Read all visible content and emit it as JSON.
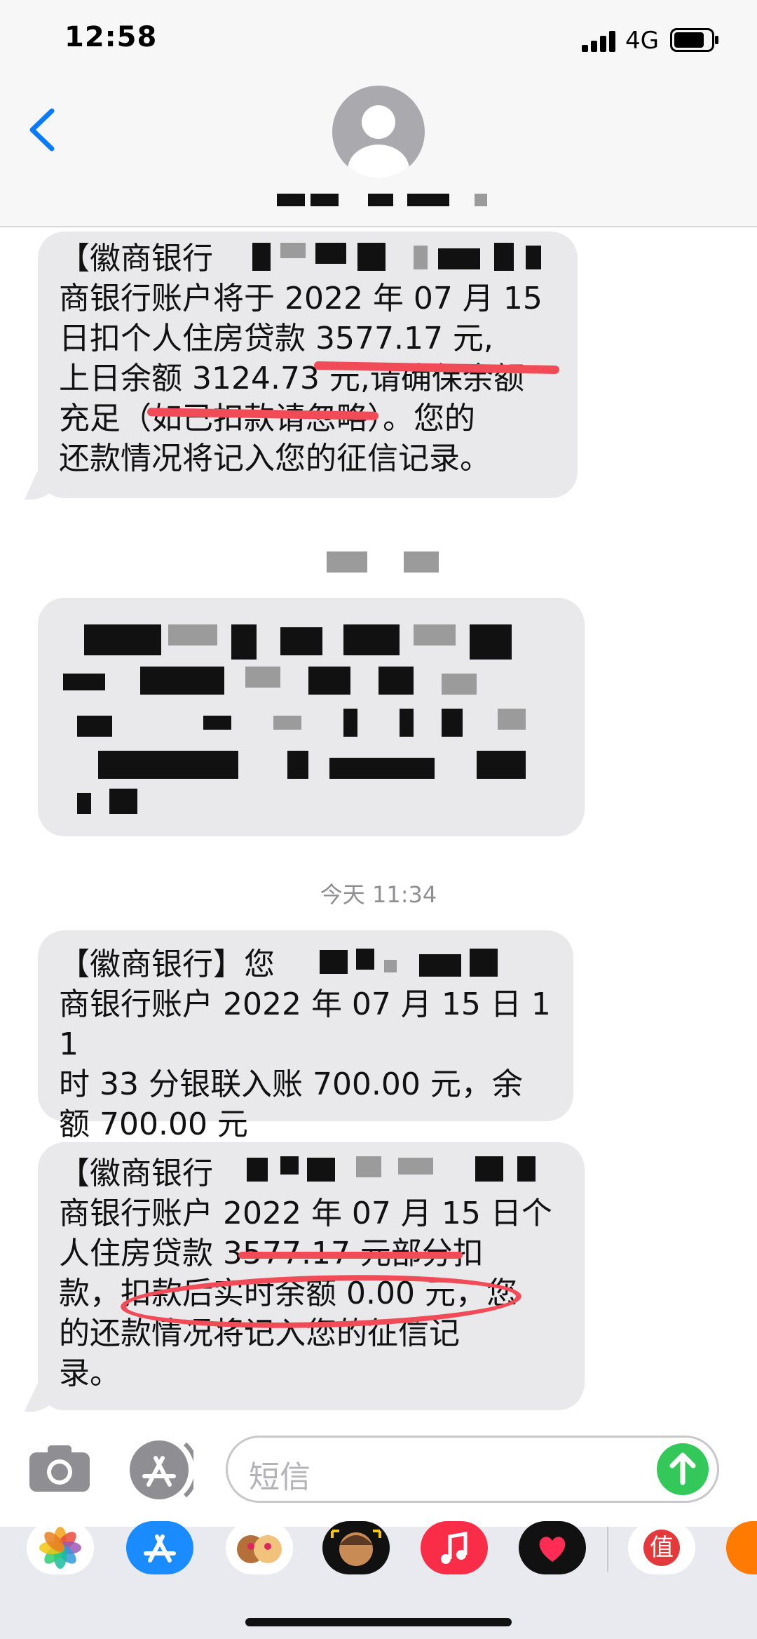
{
  "status_bar": {
    "time": "12:58",
    "network": "4G",
    "icons": [
      "signal-icon",
      "battery-icon"
    ]
  },
  "header": {
    "back_icon": "chevron-left-icon",
    "avatar_icon": "person-icon"
  },
  "messages": [
    {
      "lines": [
        "【徽商银行",
        "商银行账户将于 2022 年 07 月 15",
        "日扣个人住房贷款 3577.17 元,",
        "上日余额 3124.73 元,请确保余额",
        "充足（如已扣款请忽略）。您的",
        "还款情况将记入您的征信记录。"
      ]
    },
    {
      "lines": []
    },
    {
      "lines": [
        "【徽商银行】您",
        "商银行账户 2022 年 07 月 15 日 11",
        "时 33 分银联入账 700.00 元，余",
        "额 700.00 元"
      ]
    },
    {
      "lines": [
        "【徽商银行",
        "商银行账户 2022 年 07 月 15 日个",
        "人住房贷款 3577.17 元部分扣",
        "款，扣款后实时余额 0.00 元，您",
        "的还款情况将记入您的征信记",
        "录。"
      ]
    }
  ],
  "timestamps": {
    "today": "今天 11:34"
  },
  "input_bar": {
    "placeholder": "短信",
    "camera_icon": "camera-icon",
    "appstore_icon": "appstore-icon",
    "send_icon": "arrow-up-icon"
  },
  "app_drawer": {
    "apps": [
      "photos-icon",
      "appstore-icon",
      "memoji-icon",
      "animoji-icon",
      "music-icon",
      "digital-touch-icon",
      "zhi-app-icon",
      "orange-app-icon"
    ],
    "zhi_label": "值"
  }
}
